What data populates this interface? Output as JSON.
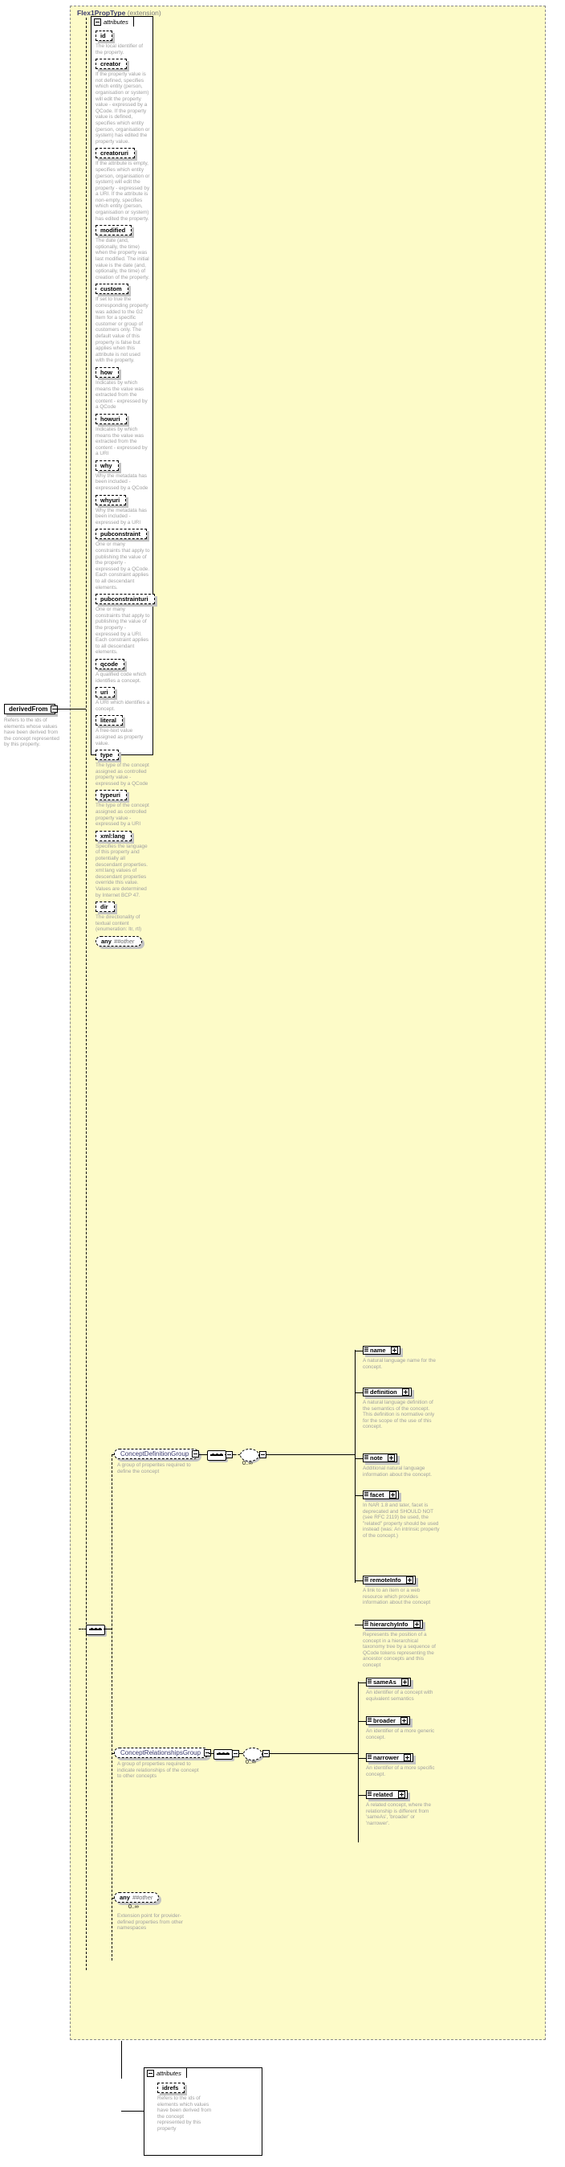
{
  "type": {
    "name": "Flex1PropType",
    "qualifier": "(extension)"
  },
  "attributes_panel": {
    "tab_label": "attributes",
    "items": [
      {
        "name": "id",
        "doc": "The local identifier of the property."
      },
      {
        "name": "creator",
        "doc": "If the property value is not defined, specifies which entity (person, organisation or system) will edit the property value - expressed by a QCode. If the property value is defined, specifies which entity (person, organisation or system) has edited the property value."
      },
      {
        "name": "creatoruri",
        "doc": "If the attribute is empty, specifies which entity (person, organisation or system) will edit the property - expressed by a URI. If the attribute is non-empty, specifies which entity (person, organisation or system) has edited the property."
      },
      {
        "name": "modified",
        "doc": "The date (and, optionally, the time) when the property was last modified. The initial value is the date (and, optionally, the time) of creation of the property."
      },
      {
        "name": "custom",
        "doc": "If set to true the corresponding property was added to the G2 Item for a specific customer or group of customers only. The default value of this property is false but applies when this attribute is not used with the property."
      },
      {
        "name": "how",
        "doc": "Indicates by which means the value was extracted from the content - expressed by a QCode"
      },
      {
        "name": "howuri",
        "doc": "Indicates by which means the value was extracted from the content - expressed by a URI"
      },
      {
        "name": "why",
        "doc": "Why the metadata has been included - expressed by a QCode"
      },
      {
        "name": "whyuri",
        "doc": "Why the metadata has been included - expressed by a URI"
      },
      {
        "name": "pubconstraint",
        "doc": "One or many constraints that apply to publishing the value of the property - expressed by a QCode. Each constraint applies to all descendant elements."
      },
      {
        "name": "pubconstrainturi",
        "doc": "One or many constraints that apply to publishing the value of the property - expressed by a URI. Each constraint applies to all descendant elements."
      },
      {
        "name": "qcode",
        "doc": "A qualified code which identifies a concept."
      },
      {
        "name": "uri",
        "doc": "A URI which identifies a concept."
      },
      {
        "name": "literal",
        "doc": "A free-text value assigned as property value."
      },
      {
        "name": "type",
        "doc": "The type of the concept assigned as controlled property value - expressed by a QCode"
      },
      {
        "name": "typeuri",
        "doc": "The type of the concept assigned as controlled property value - expressed by a URI"
      },
      {
        "name": "xml:lang",
        "doc": "Specifies the language of this property and potentially all descendant properties. xml:lang values of descendant properties override this value. Values are determined by Internet BCP 47."
      },
      {
        "name": "dir",
        "doc": "The directionality of textual content (enumeration: ltr, rtl)"
      }
    ],
    "any_other": {
      "keyword": "any",
      "namespace": "##other"
    }
  },
  "derived_from": {
    "name": "derivedFrom",
    "doc": "Refers to the ids of elements whose values have been derived from the concept represented by this property."
  },
  "groups": [
    {
      "name": "ConceptDefinitionGroup",
      "doc": "A group of properites required to define the concept",
      "cardinality": "0..∞",
      "elements": [
        {
          "name": "name",
          "doc": "A natural language name for the concept."
        },
        {
          "name": "definition",
          "doc": "A natural language definition of the semantics of the concept. This definition is normative only for the scope of the use of this concept."
        },
        {
          "name": "note",
          "doc": "Additional natural language information about the concept."
        },
        {
          "name": "facet",
          "doc": "In NAR 1.8 and later, facet is deprecated and SHOULD NOT (see RFC 2119) be used, the \"related\" property should be used instead (was: An intrinsic property of the concept.)"
        },
        {
          "name": "remoteInfo",
          "doc": "A link to an item or a web resource which provides information about the concept"
        },
        {
          "name": "hierarchyInfo",
          "doc": "Represents the position of a concept in a hierarchical taxonomy tree by a sequence of QCode tokens representing the ancestor concepts and this concept"
        }
      ]
    },
    {
      "name": "ConceptRelationshipsGroup",
      "doc": "A group of properties required to indicate relationships of the concept to other concepts",
      "cardinality": "0..∞",
      "elements": [
        {
          "name": "sameAs",
          "doc": "An identifier of a concept with equivalent semantics"
        },
        {
          "name": "broader",
          "doc": "An identifier of a more generic concept."
        },
        {
          "name": "narrower",
          "doc": "An identifier of a more specific concept."
        },
        {
          "name": "related",
          "doc": "A related concept, where the relationship is different from 'sameAs', 'broader' or 'narrower'."
        }
      ]
    }
  ],
  "extension_any": {
    "keyword": "any",
    "namespace": "##other",
    "cardinality": "0..∞",
    "doc": "Extension point for provider-defined properties from other namespaces"
  },
  "bottom_attributes_panel": {
    "tab_label": "attributes",
    "items": [
      {
        "name": "idrefs",
        "doc": "Refers to the ids of elements which values have been derived from the concept represented by this property"
      }
    ]
  },
  "icons": {
    "collapse": "minus-box-icon",
    "expand": "plus-box-icon",
    "sequence": "sequence-icon",
    "choice": "choice-icon",
    "element": "element-icon"
  },
  "colors": {
    "container_bg": "#fdfbc8",
    "doc_text": "#a0a0a0",
    "type_name": "#3b3b6e",
    "shadow": "#c3c3c3"
  }
}
